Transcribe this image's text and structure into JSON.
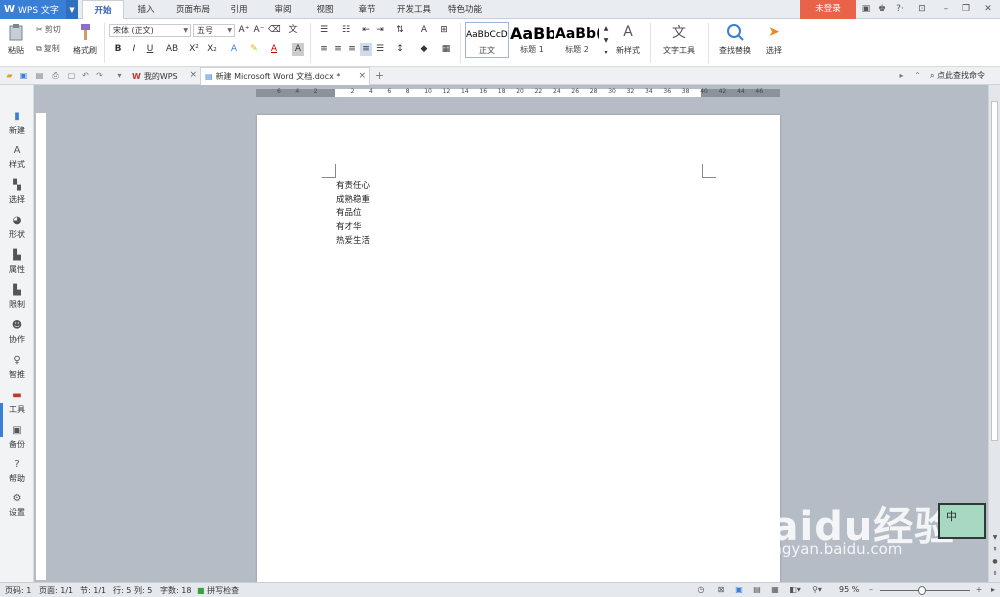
{
  "app": {
    "name": "WPS 文字",
    "login_label": "未登录"
  },
  "menu": {
    "tabs": [
      "开始",
      "插入",
      "页面布局",
      "引用",
      "审阅",
      "视图",
      "章节",
      "开发工具",
      "特色功能"
    ],
    "active_index": 0
  },
  "ribbon": {
    "paste_label": "粘贴",
    "cut_label": "剪切",
    "copy_label": "复制",
    "format_painter_label": "格式刷",
    "font_name": "宋体 (正文)",
    "font_size": "五号",
    "styles": [
      {
        "preview": "AaBbCcDd",
        "name": "正文"
      },
      {
        "preview": "AaBb",
        "name": "标题 1"
      },
      {
        "preview": "AaBb(",
        "name": "标题 2"
      }
    ],
    "new_style_label": "新样式",
    "text_tools_label": "文字工具",
    "find_replace_label": "查找替换",
    "select_label": "选择"
  },
  "doc_tabs": [
    {
      "label": "我的WPS"
    },
    {
      "label": "新建 Microsoft Word 文档.docx *"
    }
  ],
  "search_command_label": "点此查找命令",
  "sidebar": {
    "items": [
      "新建",
      "样式",
      "选择",
      "形状",
      "属性",
      "限制",
      "协作",
      "智推",
      "工具",
      "备份",
      "帮助",
      "设置"
    ]
  },
  "ruler": {
    "h_numbers": [
      "6",
      "4",
      "2",
      "2",
      "4",
      "6",
      "8",
      "10",
      "12",
      "14",
      "16",
      "18",
      "20",
      "22",
      "24",
      "26",
      "28",
      "30",
      "32",
      "34",
      "36",
      "38",
      "40",
      "42",
      "44",
      "46"
    ]
  },
  "document": {
    "lines": [
      "有责任心",
      "成熟稳重",
      "有品位",
      "有才华",
      "热爱生活"
    ]
  },
  "status": {
    "page": "页码: 1",
    "pages": "页面: 1/1",
    "section": "节: 1/1",
    "row": "行: 5",
    "col": "列: 5",
    "words": "字数: 18",
    "spellcheck": "拼写检查",
    "zoom": "95 %"
  },
  "ime": {
    "label": "中"
  },
  "watermark": {
    "logo": "Baidu经验",
    "url": "jingyan.baidu.com"
  }
}
